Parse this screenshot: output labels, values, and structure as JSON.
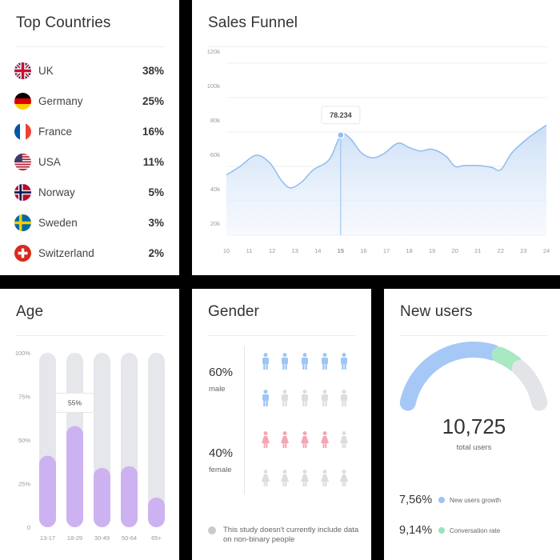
{
  "top_countries": {
    "title": "Top Countries",
    "items": [
      {
        "name": "UK",
        "pct": "38%",
        "flag": "uk-flag-icon"
      },
      {
        "name": "Germany",
        "pct": "25%",
        "flag": "germany-flag-icon"
      },
      {
        "name": "France",
        "pct": "16%",
        "flag": "france-flag-icon"
      },
      {
        "name": "USA",
        "pct": "11%",
        "flag": "usa-flag-icon"
      },
      {
        "name": "Norway",
        "pct": "5%",
        "flag": "norway-flag-icon"
      },
      {
        "name": "Sweden",
        "pct": "3%",
        "flag": "sweden-flag-icon"
      },
      {
        "name": "Switzerland",
        "pct": "2%",
        "flag": "switzerland-flag-icon"
      }
    ]
  },
  "sales_funnel": {
    "title": "Sales Funnel",
    "tooltip": "78.234",
    "chart_data": {
      "type": "area",
      "x": [
        10,
        11,
        12,
        13,
        14,
        15,
        16,
        17,
        18,
        19,
        20,
        21,
        22,
        23,
        24
      ],
      "x_tick_labels": [
        "10",
        "11",
        "12",
        "13",
        "14",
        "15",
        "16",
        "17",
        "18",
        "19",
        "20",
        "21",
        "22",
        "23",
        "24"
      ],
      "y_tick_labels": [
        "20k",
        "40k",
        "60k",
        "80k",
        "100k",
        "120k"
      ],
      "ylim": [
        20000,
        120000
      ],
      "highlight_x": 15,
      "highlight_value": 78234,
      "series": [
        {
          "color": "#8fbdee",
          "points": [
            [
              10.0,
              55000
            ],
            [
              10.6,
              60000
            ],
            [
              11.3,
              66500
            ],
            [
              11.9,
              62000
            ],
            [
              12.4,
              52000
            ],
            [
              12.8,
              47500
            ],
            [
              13.3,
              51000
            ],
            [
              13.8,
              58000
            ],
            [
              14.5,
              64000
            ],
            [
              15.0,
              78000
            ],
            [
              15.4,
              76500
            ],
            [
              15.9,
              68000
            ],
            [
              16.4,
              65000
            ],
            [
              16.9,
              67500
            ],
            [
              17.5,
              73500
            ],
            [
              18.0,
              71000
            ],
            [
              18.5,
              69000
            ],
            [
              19.0,
              70000
            ],
            [
              19.6,
              66000
            ],
            [
              20.0,
              60000
            ],
            [
              20.4,
              60500
            ],
            [
              21.0,
              60500
            ],
            [
              21.6,
              59500
            ],
            [
              22.0,
              58000
            ],
            [
              22.5,
              68000
            ],
            [
              23.2,
              76500
            ],
            [
              24.0,
              84000
            ]
          ]
        }
      ]
    }
  },
  "age": {
    "title": "Age",
    "tooltip": "55%",
    "chart_data": {
      "type": "bar",
      "categories": [
        "13-17",
        "18-29",
        "30-49",
        "50-64",
        "65+"
      ],
      "values": [
        41,
        58,
        34,
        35,
        17
      ],
      "y_tick_labels": [
        "0",
        "25%",
        "50%",
        "75%",
        "100%"
      ],
      "ylim": [
        0,
        100
      ],
      "bar_color": "#cdb2f1",
      "track_color": "#e5e7eb",
      "highlight_category": "18-29"
    }
  },
  "gender": {
    "title": "Gender",
    "male_pct": "60%",
    "male_label": "male",
    "female_pct": "40%",
    "female_label": "female",
    "male_color": "#9ec6f3",
    "female_color": "#f2a7b3",
    "inactive_color": "#dcdde1",
    "male_active_count": 6,
    "female_active_count": 4,
    "icons_per_group": 10,
    "note": "This study doesn't currently include data on non-binary people"
  },
  "new_users": {
    "title": "New users",
    "total": "10,725",
    "total_label": "total users",
    "segment_colors": [
      "#a6c8f6",
      "#a8e8c3",
      "#e3e4e8"
    ],
    "segment_fractions": [
      0.52,
      0.11,
      0.2
    ],
    "stats": [
      {
        "value": "7,56%",
        "label": "New users growth",
        "color": "#9cc3f2"
      },
      {
        "value": "9,14%",
        "label": "Conversation rate",
        "color": "#98e3b8"
      }
    ]
  }
}
